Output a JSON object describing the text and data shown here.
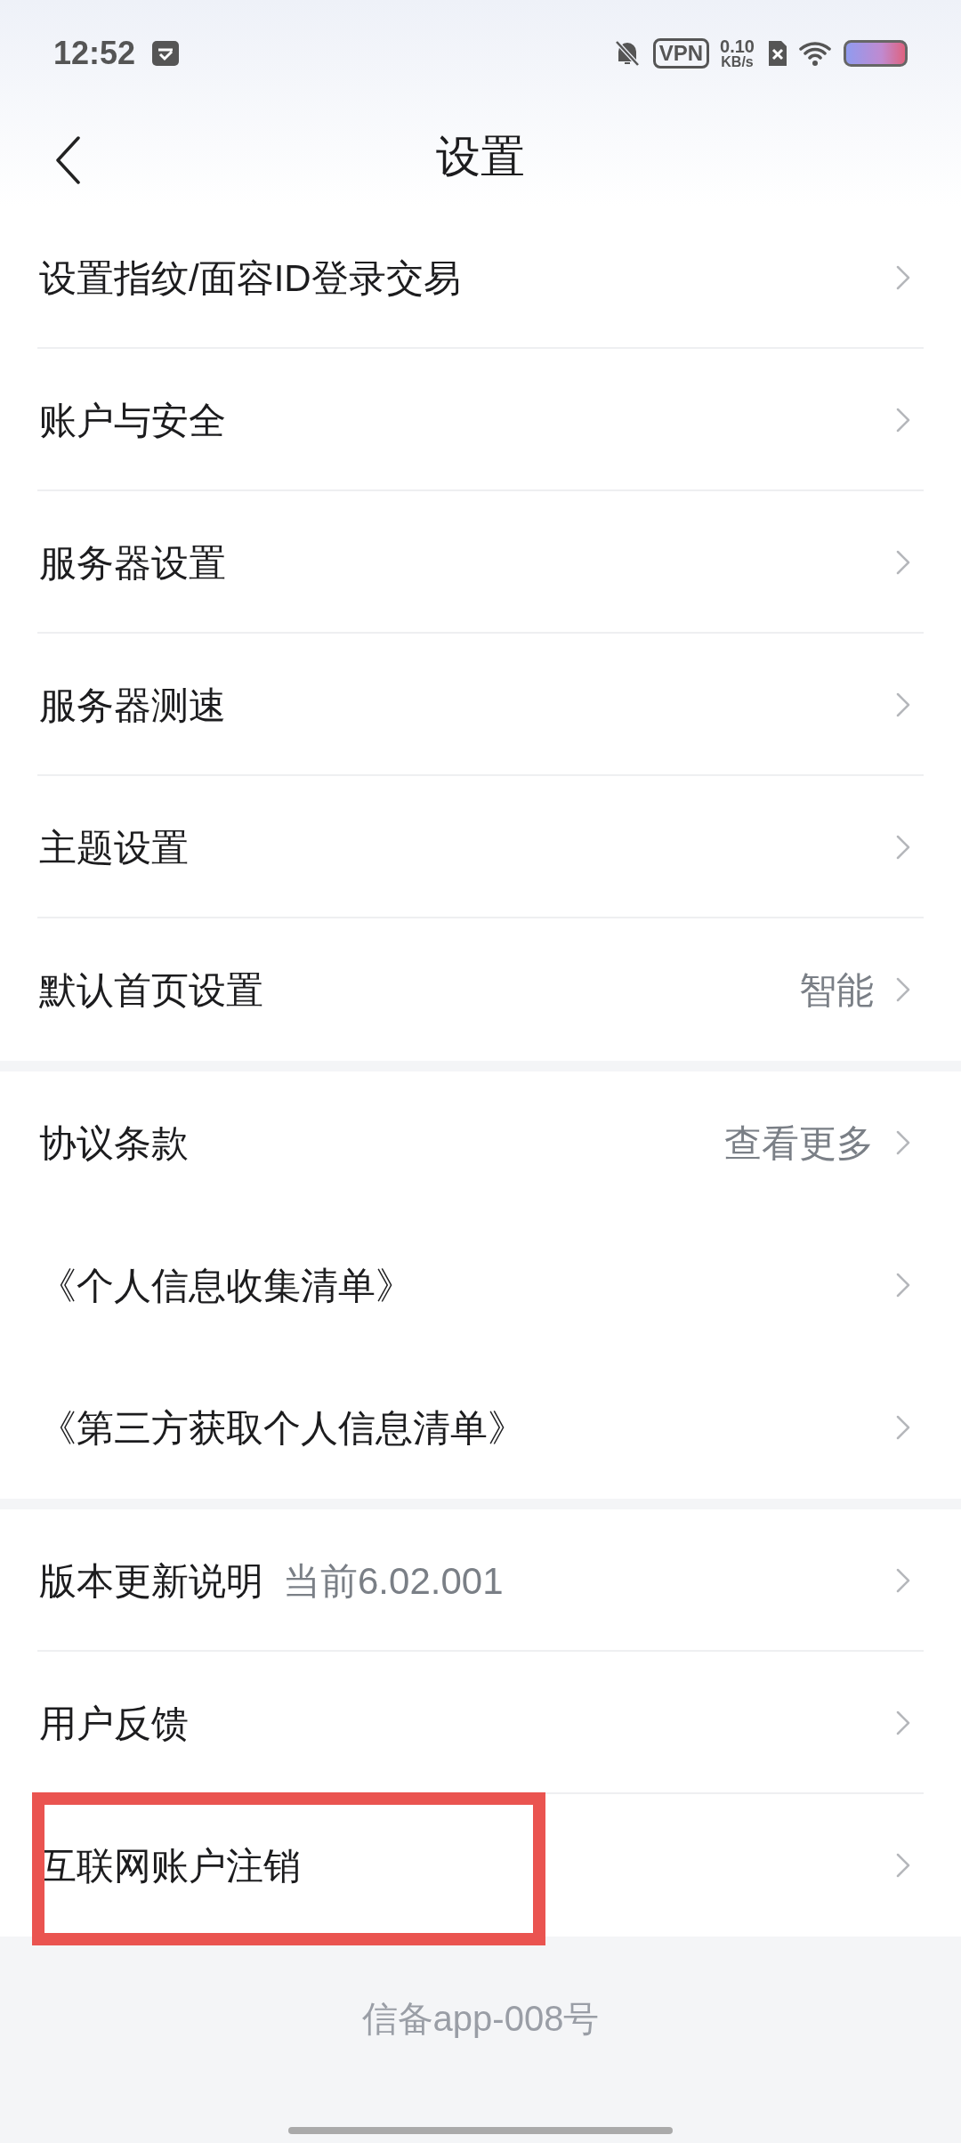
{
  "status_bar": {
    "time": "12:52",
    "vpn": "VPN",
    "speed": "0.10",
    "speed_unit": "KB/s"
  },
  "header": {
    "title": "设置"
  },
  "sections": [
    {
      "items": [
        {
          "label": "设置指纹/面容ID登录交易",
          "highlighted": false
        },
        {
          "label": "账户与安全",
          "highlighted": false
        },
        {
          "label": "服务器设置",
          "highlighted": false
        },
        {
          "label": "服务器测速",
          "highlighted": false
        },
        {
          "label": "主题设置",
          "highlighted": false
        },
        {
          "label": "默认首页设置",
          "value": "智能",
          "highlighted": false
        }
      ],
      "dividers": true
    },
    {
      "items": [
        {
          "label": "协议条款",
          "value": "查看更多",
          "highlighted": false
        },
        {
          "label": "《个人信息收集清单》",
          "highlighted": false
        },
        {
          "label": "《第三方获取个人信息清单》",
          "highlighted": false
        }
      ],
      "dividers": false
    },
    {
      "items": [
        {
          "label": "版本更新说明",
          "note": "当前6.02.001",
          "highlighted": false
        },
        {
          "label": "用户反馈",
          "highlighted": false
        },
        {
          "label": "互联网账户注销",
          "highlighted": true
        }
      ],
      "dividers": true
    }
  ],
  "footer": "信备app-008号"
}
